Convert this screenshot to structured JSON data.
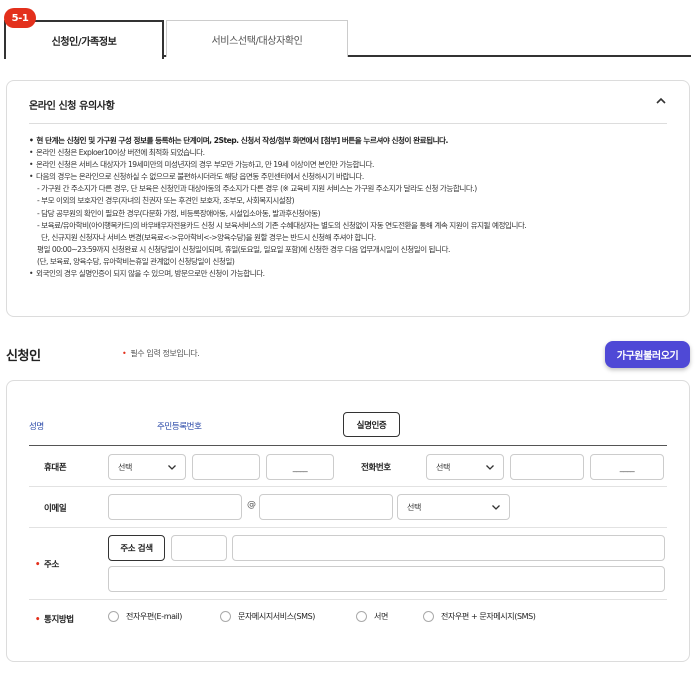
{
  "step": {
    "badge": "5-1"
  },
  "tabs": [
    {
      "label": "신청인/가족정보",
      "active": true
    },
    {
      "label": "서비스선택/대상자확인",
      "active": false
    }
  ],
  "notice": {
    "title": "온라인 신청 유의사항",
    "lines": [
      "현 단계는 신청인 및 가구원 구성 정보를 등록하는 단계이며, 2Step. 신청서 작성/첨부 화면에서 [첨부] 버튼을 누르셔야 신청이 완료됩니다.",
      "온라인 신청은 Exploer10이상 버전에 최적화 되었습니다.",
      "온라인 신청은 서비스 대상자가 19세미만의 미성년자의 경우 부모만 가능하고, 만 19세 이상이면 본인만 가능합니다.",
      "다음의 경우는 온라인으로 신청하실 수 없으므로 불편하시더라도 해당 읍면동 주민센터에서 신청하시기 바랍니다.",
      "- 가구원 간 주소지가 다른 경우, 단 보육은 신청인과 대상아동의 주소지가 다른 경우 (※ 교육비 지원 서비스는 가구원 주소지가 달라도 신청 가능합니다.)",
      "- 부모 이외의 보호자인 경우(자녀의 친권자 또는 후견인 보호자, 조부모, 사회복지시설장)",
      "- 담당 공무원의 확인이 필요한 경우(다문화 가정, 비등록장애아동, 시설입소아동, 발과후신청아동)",
      "- 보육료/유아학비(아이행복카드)의 바우배우자전용카드 신청 시 보육서비스의 기존 수혜대상자는 별도의 신청없이 자동 연도전환을 통해 계속 지원이 유지될 예정입니다.",
      "단, 신규지원 신청자나 서비스 변경(보육료<->유아학비<->양육수당)을 원할 경우는 반드시 신청해 주셔야 합니다.",
      "평일 00:00~23:59까지 신청완료 시 신청당일이 신청일이되며, 휴일(토요일, 일요일 포함)에 신청한 경우 다음 업무개시일이 신청일이 됩니다.",
      "(단, 보육료, 양육수당, 유아학비는휴일 관계없이 신청당일이 신청일)",
      "외국인의 경우 실명인증이 되지 않을 수 있으며, 방문으로만 신청이 가능합니다."
    ]
  },
  "applicant": {
    "section_title": "신청인",
    "required_note": "필수 입력 정보입니다.",
    "load_button": "가구원불러오기",
    "name_label": "성명",
    "rrn_label": "주민등록번호",
    "auth_button": "실명인증",
    "mobile_label": "휴대폰",
    "mobile_select": "선택",
    "mobile_last_placeholder": "____",
    "phone_label": "전화번호",
    "phone_select": "선택",
    "phone_last_placeholder": "____",
    "email_label": "이메일",
    "email_at": "@",
    "email_domain_select": "선택",
    "address_label": "주소",
    "address_search_button": "주소 검색",
    "notify_label": "통지방법",
    "notify_options": [
      "전자우편(E-mail)",
      "문자메시지서비스(SMS)",
      "서면",
      "전자우편 + 문자메시지(SMS)"
    ]
  },
  "colors": {
    "accent": "#4f49d6",
    "badge": "#e3301c",
    "link": "#2b4aa8"
  }
}
